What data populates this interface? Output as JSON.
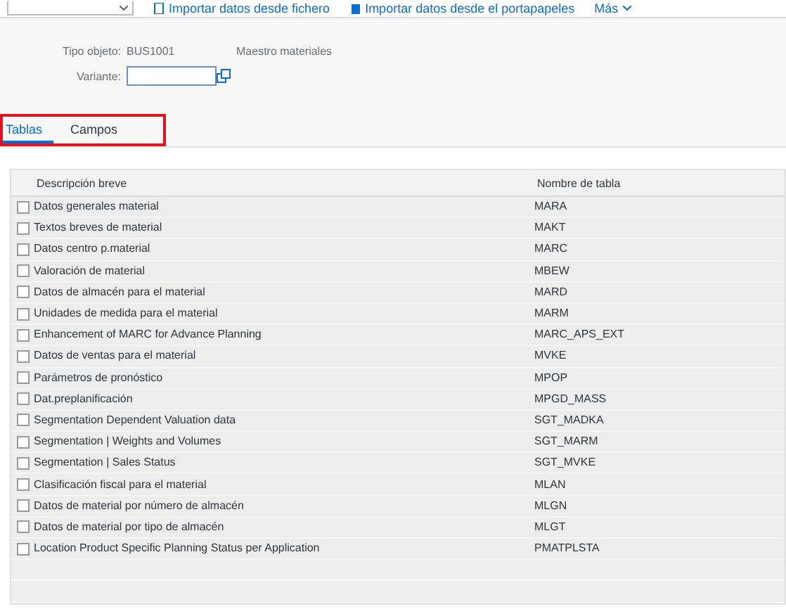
{
  "toolbar": {
    "items": [
      {
        "kind": "dropdown"
      },
      {
        "kind": "file",
        "label": "Importar datos desde fichero"
      },
      {
        "kind": "clipboard",
        "label": "Importar datos desde el portapapeles"
      },
      {
        "kind": "more",
        "label": "Más"
      }
    ]
  },
  "header": {
    "object_type_label": "Tipo objeto:",
    "object_type_value": "BUS1001",
    "object_type_description": "Maestro materiales",
    "variant_label": "Variante:"
  },
  "tabs": [
    {
      "label": "Tablas",
      "selected": true
    },
    {
      "label": "Campos",
      "selected": false
    }
  ],
  "table": {
    "columns": [
      "Descripción breve",
      "Nombre de tabla"
    ],
    "rows": [
      {
        "description": "Datos generales material",
        "table": "MARA",
        "checked": false
      },
      {
        "description": "Textos breves de material",
        "table": "MAKT",
        "checked": false
      },
      {
        "description": "Datos centro p.material",
        "table": "MARC",
        "checked": false
      },
      {
        "description": "Valoración de material",
        "table": "MBEW",
        "checked": false
      },
      {
        "description": "Datos de almacén para el material",
        "table": "MARD",
        "checked": false
      },
      {
        "description": "Unidades de medida para el material",
        "table": "MARM",
        "checked": false
      },
      {
        "description": "Enhancement of MARC for Advance Planning",
        "table": "MARC_APS_EXT",
        "checked": false
      },
      {
        "description": "Datos de ventas para el material",
        "table": "MVKE",
        "checked": false
      },
      {
        "description": "Parámetros de pronóstico",
        "table": "MPOP",
        "checked": false
      },
      {
        "description": "Dat.preplanificación",
        "table": "MPGD_MASS",
        "checked": false
      },
      {
        "description": "Segmentation Dependent  Valuation data",
        "table": "SGT_MADKA",
        "checked": false
      },
      {
        "description": "Segmentation | Weights and Volumes",
        "table": "SGT_MARM",
        "checked": false
      },
      {
        "description": "Segmentation | Sales Status",
        "table": "SGT_MVKE",
        "checked": false
      },
      {
        "description": "Clasificación fiscal para el material",
        "table": "MLAN",
        "checked": false
      },
      {
        "description": "Datos de material por número de almacén",
        "table": "MLGN",
        "checked": false
      },
      {
        "description": "Datos de material por tipo de almacén",
        "table": "MLGT",
        "checked": false
      },
      {
        "description": "Location Product Specific Planning Status per Application",
        "table": "PMATPLSTA",
        "checked": false
      }
    ]
  }
}
